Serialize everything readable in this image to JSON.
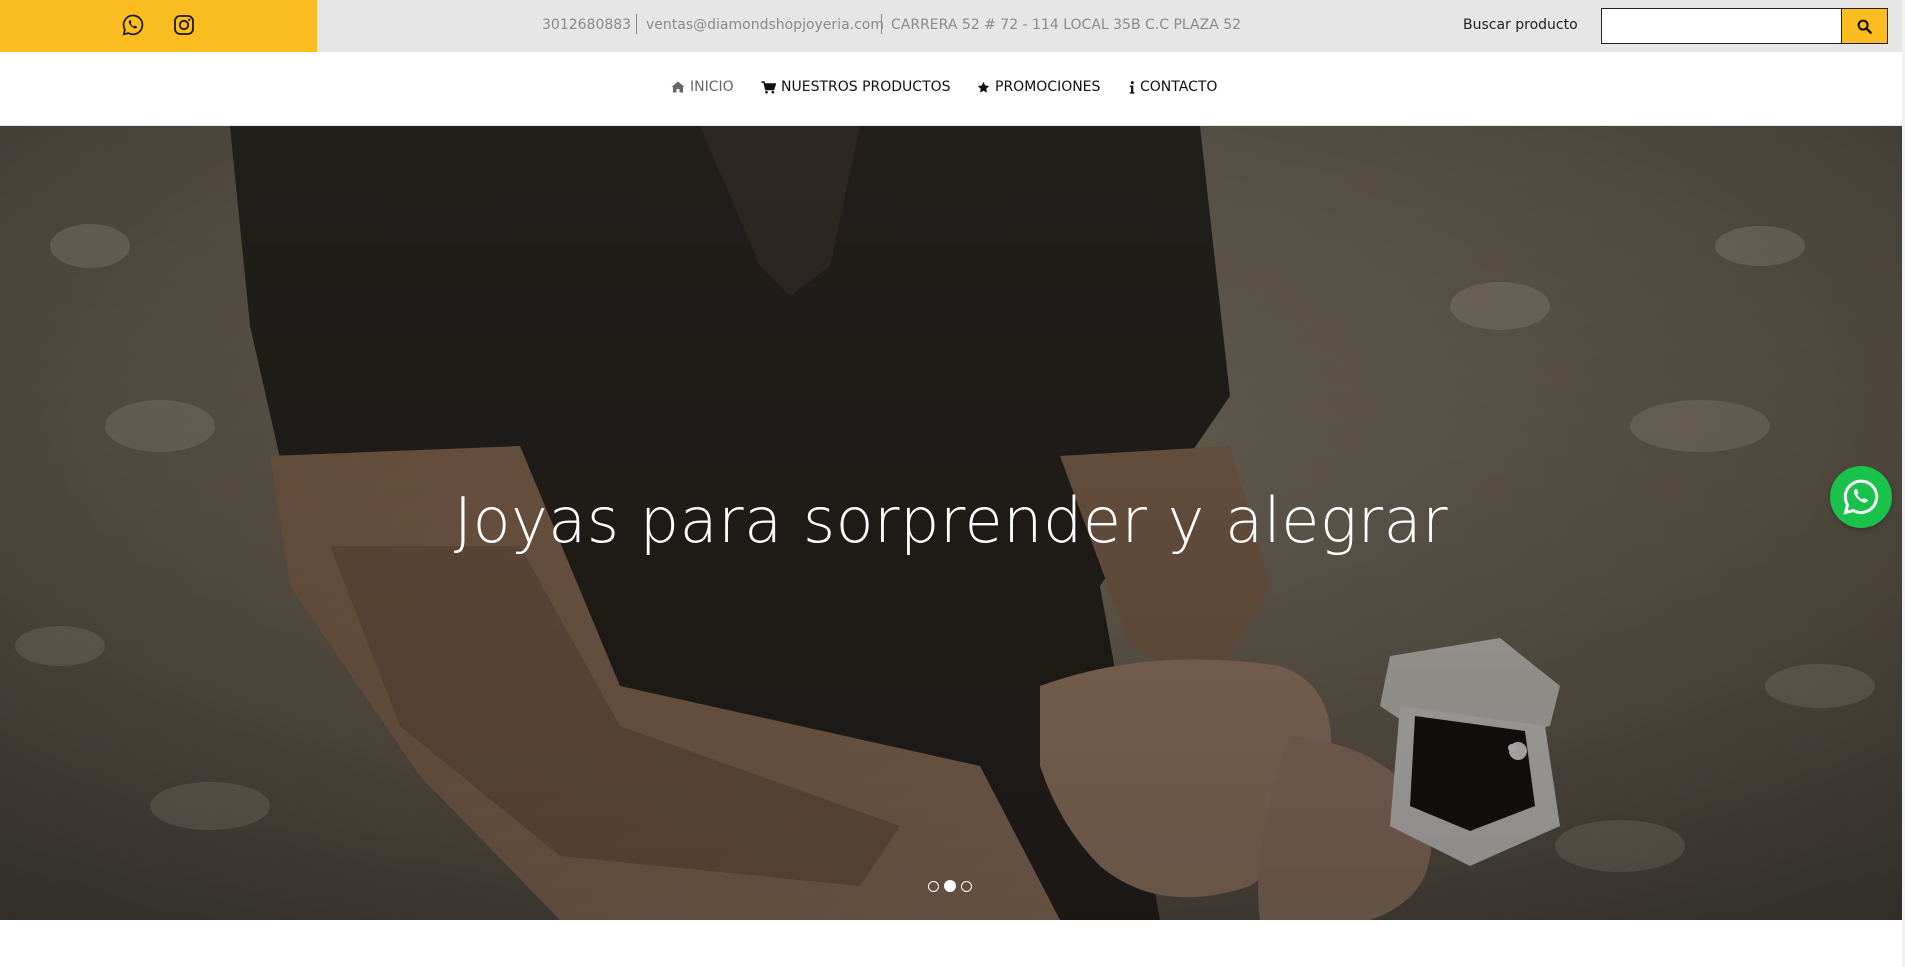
{
  "topbar": {
    "social": [
      {
        "icon": "whatsapp-icon"
      },
      {
        "icon": "instagram-icon"
      }
    ],
    "phone": "3012680883",
    "email": "ventas@diamondshopjoyeria.com",
    "address": "CARRERA 52 # 72 - 114 LOCAL 35B C.C PLAZA 52",
    "search_label": "Buscar producto",
    "search_value": "",
    "search_icon": "search-icon",
    "accent_color": "#fbbd1f"
  },
  "nav": {
    "items": [
      {
        "label": "INICIO",
        "icon": "home-icon",
        "active": true
      },
      {
        "label": "NUESTROS PRODUCTOS",
        "icon": "cart-icon",
        "active": false
      },
      {
        "label": "PROMOCIONES",
        "icon": "star-icon",
        "active": false
      },
      {
        "label": "CONTACTO",
        "icon": "info-icon",
        "active": false
      }
    ]
  },
  "hero": {
    "title": "Joyas para sorprender y alegrar",
    "slides": 3,
    "active_slide": 2
  },
  "floating": {
    "icon": "whatsapp-icon",
    "color": "#19c24a"
  }
}
